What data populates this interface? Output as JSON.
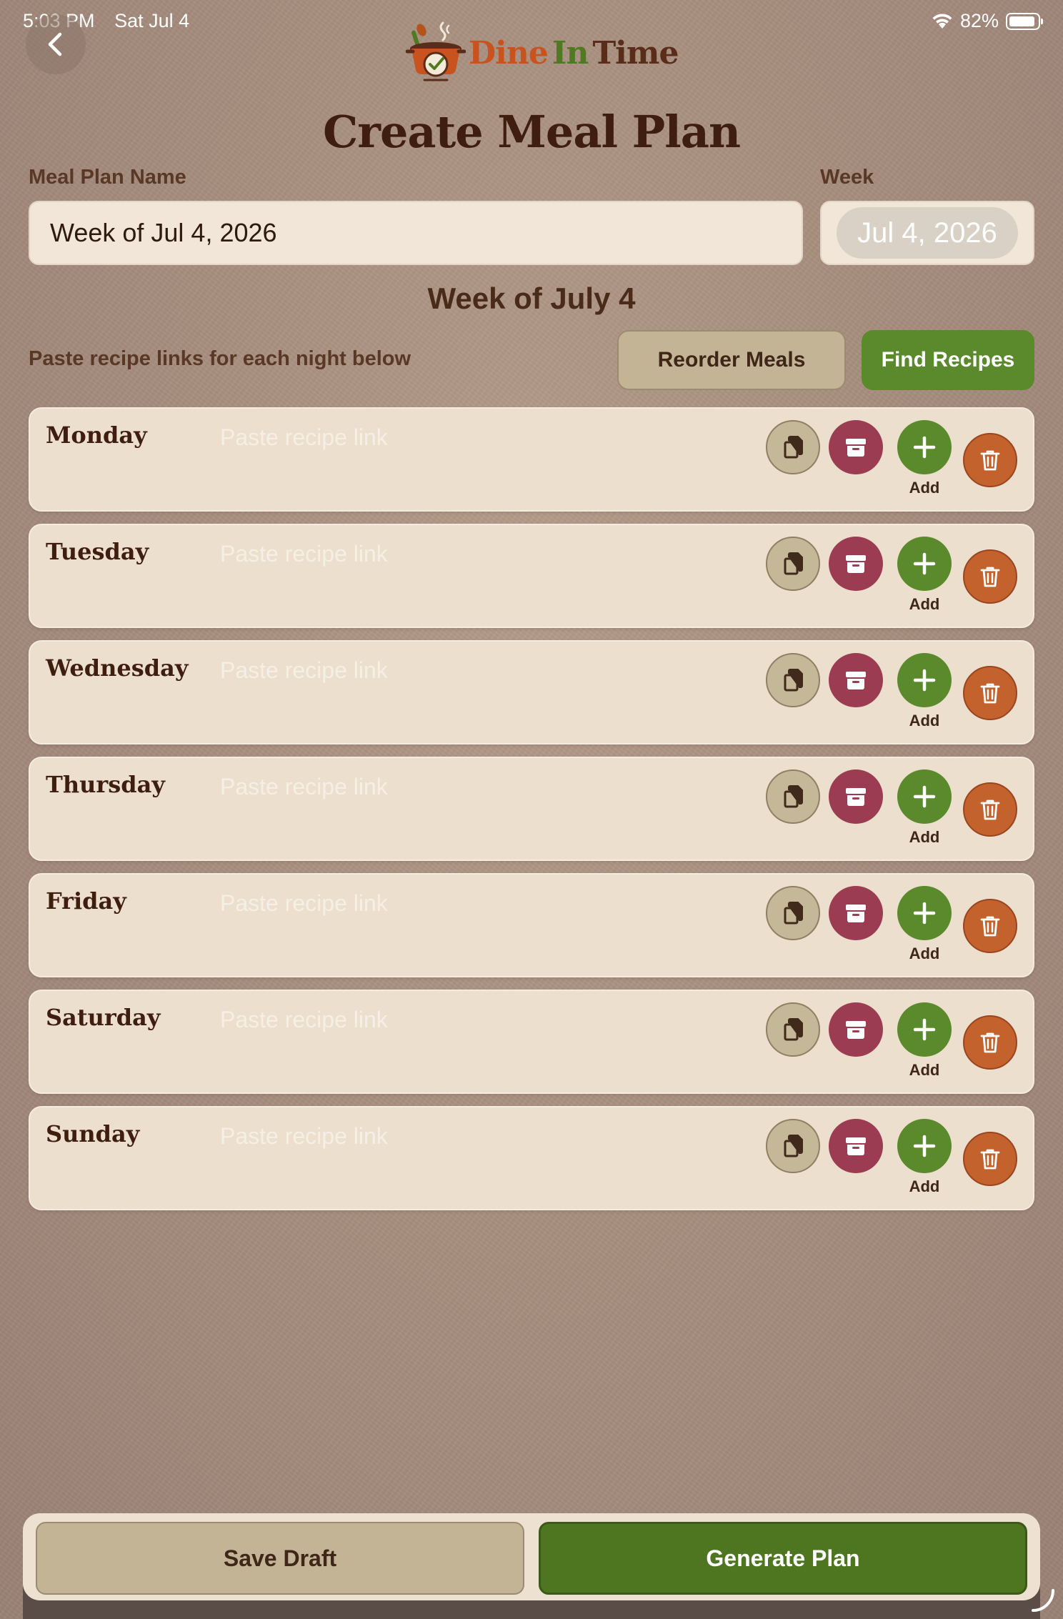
{
  "status_bar": {
    "time": "5:03 PM",
    "date": "Sat Jul 4",
    "battery": "82%"
  },
  "logo": {
    "part1": "Dine",
    "part2": "In",
    "part3": "Time"
  },
  "page_title": "Create Meal Plan",
  "form": {
    "name_label": "Meal Plan Name",
    "name_value": "Week of Jul 4, 2026",
    "week_label": "Week",
    "week_value": "Jul 4, 2026"
  },
  "week_heading": "Week of July 4",
  "instructions": "Paste recipe links for each night below",
  "buttons": {
    "reorder": "Reorder Meals",
    "find": "Find Recipes",
    "add": "Add",
    "save_draft": "Save Draft",
    "generate": "Generate Plan"
  },
  "link_placeholder": "Paste recipe link",
  "days": [
    "Monday",
    "Tuesday",
    "Wednesday",
    "Thursday",
    "Friday",
    "Saturday",
    "Sunday"
  ],
  "colors": {
    "accent_green": "#5a8a2c",
    "archive_red": "#9c3c52",
    "delete_orange": "#c4622e",
    "copy_tan": "#c5b898"
  },
  "icons": {
    "back": "chevron-left-icon",
    "copy": "copy-icon",
    "archive": "archive-icon",
    "add": "plus-icon",
    "delete": "trash-icon"
  }
}
